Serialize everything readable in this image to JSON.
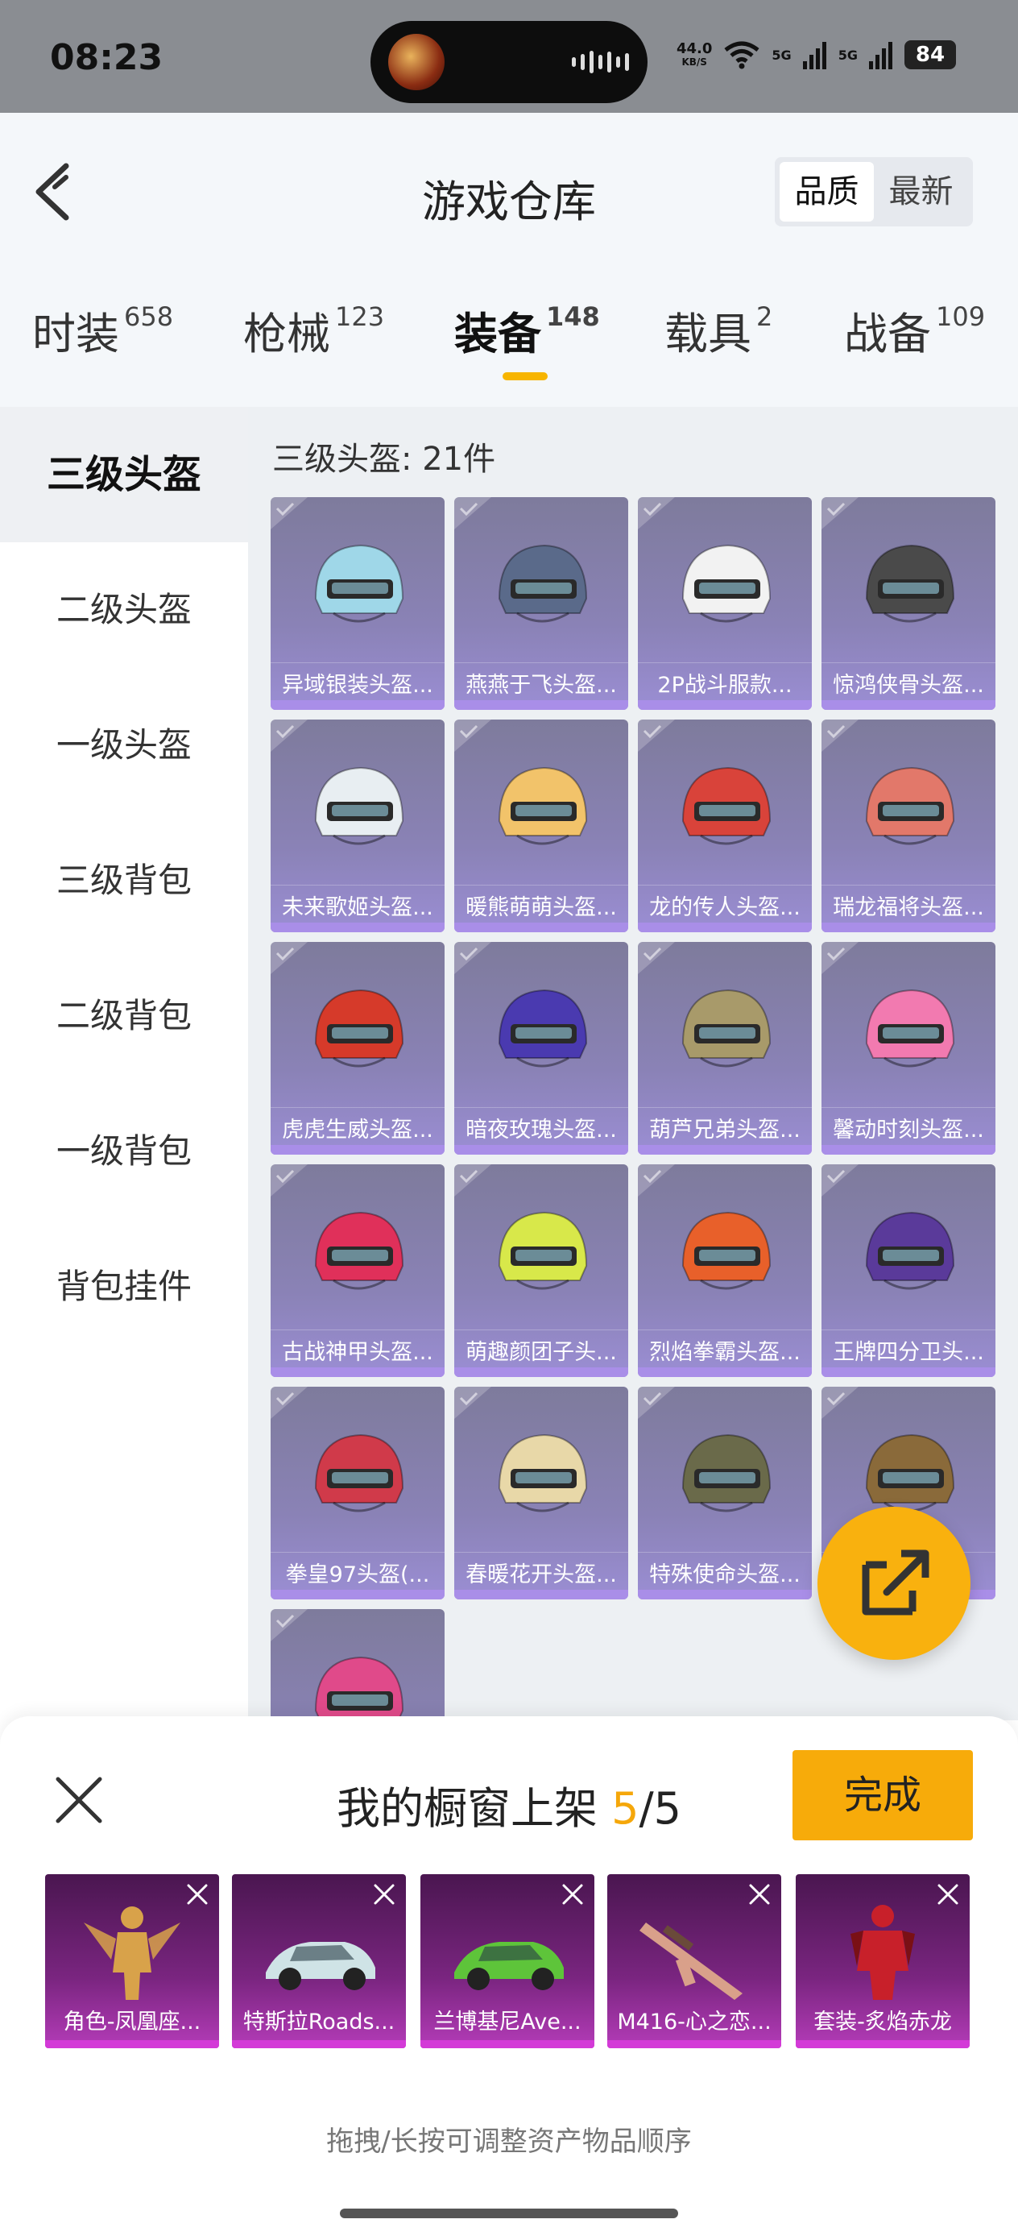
{
  "status_bar": {
    "time": "08:23",
    "net_speed": "44.0",
    "net_unit": "KB/S",
    "sim1": "5G",
    "sim2": "5G",
    "battery": "84"
  },
  "header": {
    "title": "游戏仓库",
    "sort": [
      "品质",
      "最新"
    ],
    "sort_active": 0
  },
  "tabs": [
    {
      "label": "时装",
      "count": "658"
    },
    {
      "label": "枪械",
      "count": "123"
    },
    {
      "label": "装备",
      "count": "148"
    },
    {
      "label": "载具",
      "count": "2"
    },
    {
      "label": "战备",
      "count": "109"
    }
  ],
  "sidebar": [
    {
      "label": "三级头盔"
    },
    {
      "label": "二级头盔"
    },
    {
      "label": "一级头盔"
    },
    {
      "label": "三级背包"
    },
    {
      "label": "二级背包"
    },
    {
      "label": "一级背包"
    },
    {
      "label": "背包挂件"
    }
  ],
  "content": {
    "title": "三级头盔: 21件",
    "items": [
      {
        "label": "异域银装头盔...",
        "icon": "helmet-icon",
        "color": "#9fd7e8"
      },
      {
        "label": "燕燕于飞头盔...",
        "icon": "helmet-icon",
        "color": "#5a6a8a"
      },
      {
        "label": "2P战斗服款...",
        "icon": "helmet-icon",
        "color": "#f2f2f2"
      },
      {
        "label": "惊鸿侠骨头盔...",
        "icon": "helmet-icon",
        "color": "#4a4a4a"
      },
      {
        "label": "未来歌姬头盔...",
        "icon": "helmet-icon",
        "color": "#e8eef2"
      },
      {
        "label": "暖熊萌萌头盔...",
        "icon": "helmet-icon",
        "color": "#f2c36a"
      },
      {
        "label": "龙的传人头盔...",
        "icon": "helmet-icon",
        "color": "#d9433a"
      },
      {
        "label": "瑞龙福将头盔...",
        "icon": "helmet-icon",
        "color": "#e2786a"
      },
      {
        "label": "虎虎生威头盔...",
        "icon": "helmet-icon",
        "color": "#d63a2a"
      },
      {
        "label": "暗夜玫瑰头盔...",
        "icon": "helmet-icon",
        "color": "#4a3ab0"
      },
      {
        "label": "葫芦兄弟头盔...",
        "icon": "helmet-icon",
        "color": "#a89a6a"
      },
      {
        "label": "馨动时刻头盔...",
        "icon": "helmet-icon",
        "color": "#f27ab0"
      },
      {
        "label": "古战神甲头盔...",
        "icon": "helmet-icon",
        "color": "#e0305a"
      },
      {
        "label": "萌趣颜团子头...",
        "icon": "helmet-icon",
        "color": "#d8e84a"
      },
      {
        "label": "烈焰拳霸头盔...",
        "icon": "helmet-icon",
        "color": "#e8602a"
      },
      {
        "label": "王牌四分卫头...",
        "icon": "helmet-icon",
        "color": "#5a3a9a"
      },
      {
        "label": "拳皇97头盔(...",
        "icon": "helmet-icon",
        "color": "#d03a4a"
      },
      {
        "label": "春暖花开头盔...",
        "icon": "helmet-icon",
        "color": "#e8d8a8"
      },
      {
        "label": "特殊使命头盔...",
        "icon": "helmet-icon",
        "color": "#6a6a4a"
      },
      {
        "label": "",
        "icon": "helmet-icon",
        "color": "#8a6a3a"
      },
      {
        "label": "",
        "icon": "helmet-icon",
        "color": "#e04a8a"
      }
    ]
  },
  "fab": {
    "icon": "share-icon"
  },
  "panel": {
    "title": "我的橱窗上架 ",
    "count": "5",
    "total": "/5",
    "done_label": "完成",
    "slots": [
      {
        "label": "角色-凤凰座...",
        "icon": "character-icon",
        "color": "#d8a24a"
      },
      {
        "label": "特斯拉Roads...",
        "icon": "car-icon",
        "color": "#cfe3e6"
      },
      {
        "label": "兰博基尼Ave...",
        "icon": "car-icon",
        "color": "#5ec43a"
      },
      {
        "label": "M416-心之恋...",
        "icon": "rifle-icon",
        "color": "#d9a08a"
      },
      {
        "label": "套装-炙焰赤龙",
        "icon": "suit-icon",
        "color": "#c8202a"
      }
    ],
    "hint": "拖拽/长按可调整资产物品顺序"
  }
}
